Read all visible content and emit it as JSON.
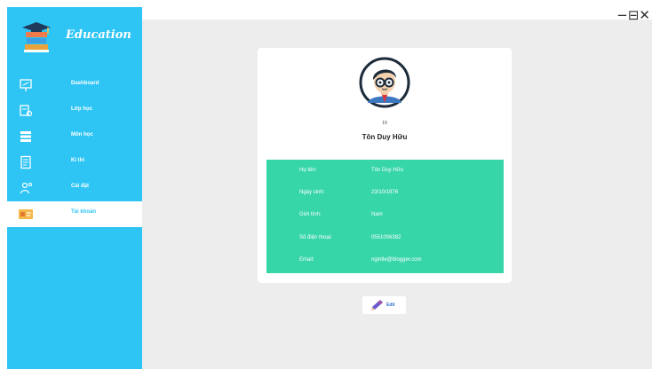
{
  "window": {
    "controls": {
      "minimize": "−",
      "maximize": "⊟",
      "close": "✕"
    }
  },
  "sidebar": {
    "brand": {
      "title": "Education",
      "logo_icon": "books-graduation-cap-icon"
    },
    "items": [
      {
        "label": "Dashboard",
        "icon": "presentation-board-icon",
        "active": false
      },
      {
        "label": "Lớp học",
        "icon": "classroom-icon",
        "active": false
      },
      {
        "label": "Môn học",
        "icon": "books-icon",
        "active": false
      },
      {
        "label": "Kì thi",
        "icon": "exam-sheet-icon",
        "active": false
      },
      {
        "label": "Cài đặt",
        "icon": "settings-person-icon",
        "active": false
      },
      {
        "label": "Tài khoản",
        "icon": "id-card-icon",
        "active": true
      }
    ]
  },
  "profile": {
    "avatar_icon": "student-avatar-icon",
    "id": "19",
    "name": "Tôn Duy Hữu",
    "fields": [
      {
        "label": "Họ tên:",
        "value": "Tôn Duy Hữu"
      },
      {
        "label": "Ngày sinh:",
        "value": "23/10/1976"
      },
      {
        "label": "Giới tính:",
        "value": "Nam"
      },
      {
        "label": "Số điện thoại:",
        "value": "0551006382"
      },
      {
        "label": "Email:",
        "value": "ngintle@blogger.com"
      }
    ]
  },
  "actions": {
    "edit_label": "Edit",
    "edit_icon": "pencil-icon"
  },
  "colors": {
    "sidebar": "#2ec5f5",
    "info_panel": "#37d6a8",
    "background": "#ededed"
  }
}
